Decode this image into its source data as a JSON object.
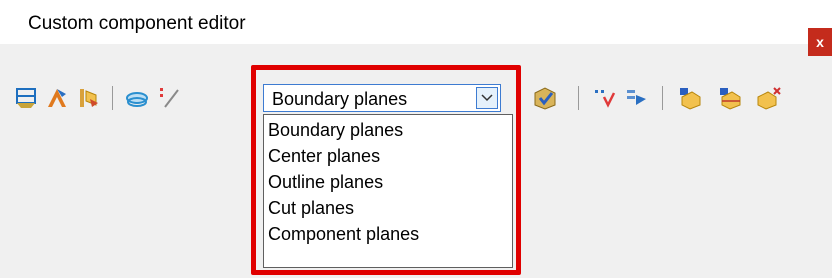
{
  "window": {
    "title": "Custom component editor",
    "close_label": "x"
  },
  "toolbar": {
    "left_icons": [
      "boundary-planes-icon",
      "move-handle-icon",
      "component-properties-icon",
      "plane-view-icon",
      "snap-line-icon"
    ],
    "right_icons": [
      "validate-component-icon",
      "add-variable-icon",
      "export-icon",
      "add-object-icon",
      "add-plane-object-icon",
      "remove-object-icon"
    ],
    "plane_type_select": {
      "selected": "Boundary planes",
      "options": [
        "Boundary planes",
        "Center planes",
        "Outline planes",
        "Cut planes",
        "Component planes"
      ]
    }
  },
  "colors": {
    "highlight": "#e00000",
    "close_button": "#c42b1c",
    "combo_border": "#3d7bd1"
  }
}
